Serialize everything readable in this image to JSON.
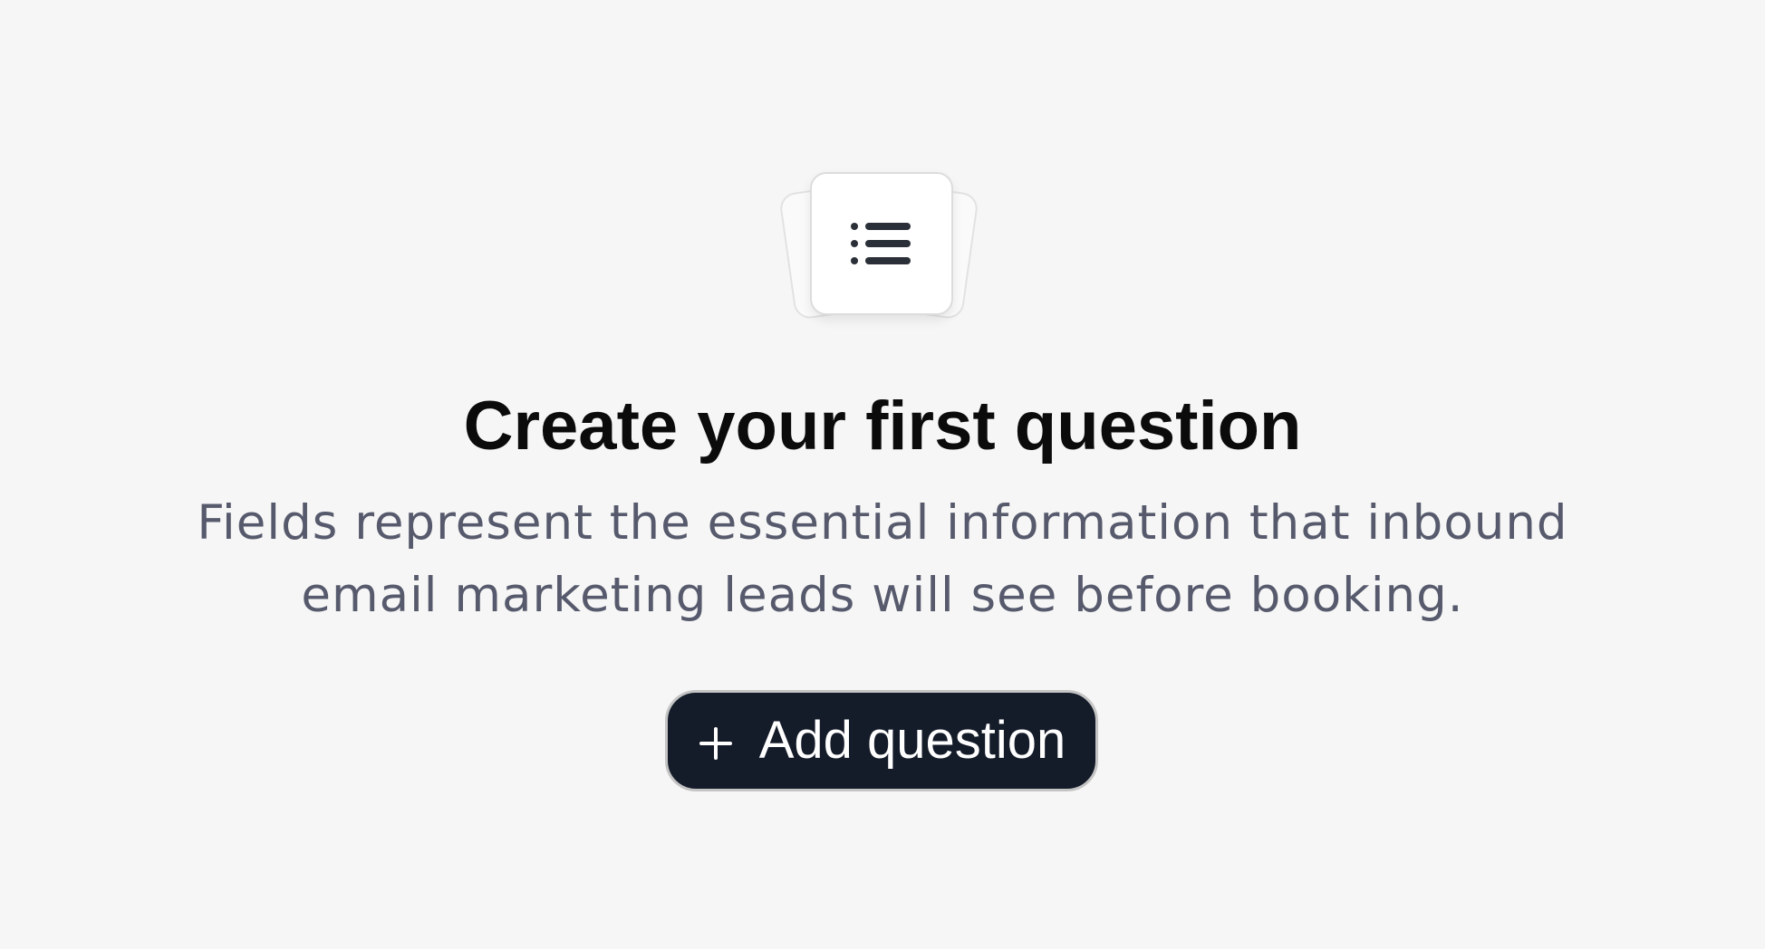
{
  "empty_state": {
    "icon": "list-icon",
    "title": "Create your first question",
    "description": "Fields represent the essential information that inbound email marketing leads will see before booking.",
    "button": {
      "icon": "plus-icon",
      "label": "Add question"
    }
  },
  "colors": {
    "background": "#f6f6f6",
    "button_background": "#141b29",
    "title": "#0b0b0c",
    "description": "#565a6c",
    "icon": "#2b2f38"
  }
}
